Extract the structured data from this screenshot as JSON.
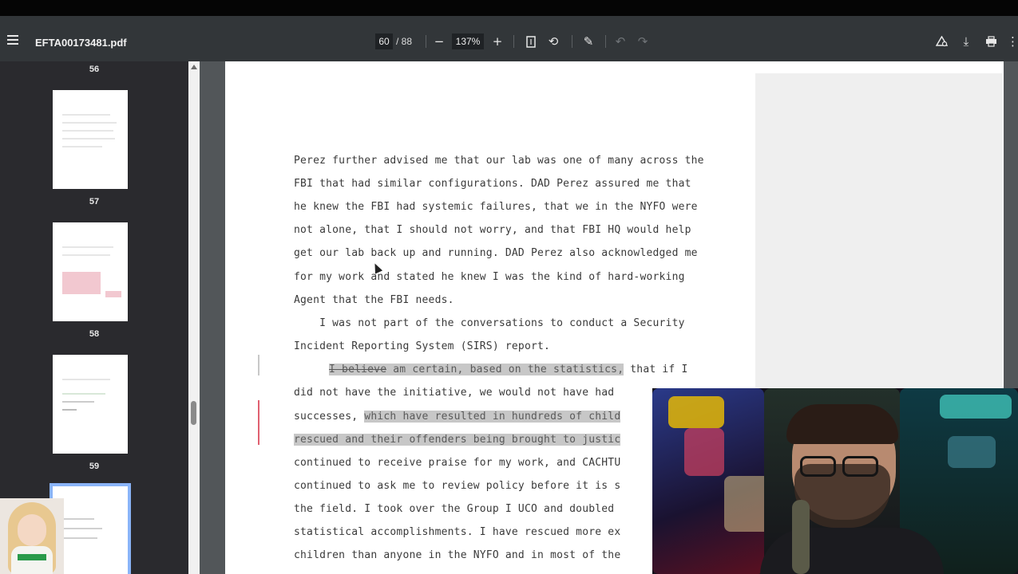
{
  "toolbar": {
    "file_name": "EFTA00173481.pdf",
    "current_page": "60",
    "total_pages": "/ 88",
    "zoom": "137%",
    "icons": [
      "menu-icon",
      "zoom-out-icon",
      "zoom-in-icon",
      "fit-page-icon",
      "rotate-icon",
      "annotate-icon",
      "undo-icon",
      "redo-icon",
      "drive-icon",
      "download-icon",
      "print-icon",
      "more-icon"
    ]
  },
  "sidebar": {
    "thumbnails": [
      {
        "label": "56"
      },
      {
        "label": "57"
      },
      {
        "label": "58"
      },
      {
        "label": "59"
      }
    ]
  },
  "document": {
    "lines": [
      "Perez further advised me that our lab was one of many across the",
      "FBI that had similar configurations. DAD Perez assured me that",
      "he knew the FBI had systemic failures, that we in the NYFO were",
      "not alone, that I should not worry, and that FBI HQ would help",
      "get our lab back up and running. DAD Perez also acknowledged me",
      "for my work and stated he knew I was the kind of hard-working",
      "Agent that the FBI needs.",
      "    I was not part of the conversations to conduct a Security",
      "Incident Reporting System (SIRS) report."
    ],
    "line_10_struck": "I believe",
    "line_10_highlight": " am certain, based on the statistics,",
    "line_10_rest": " that if I",
    "line_11": "did not have the initiative, we would not have had",
    "line_12_plain": "successes, ",
    "line_12_highlight": "which have resulted in hundreds of child",
    "line_13_highlight": "rescued and their offenders being brought to justic",
    "line_14": "continued to receive praise for my work, and CACHTU",
    "line_15": "continued to ask me to review policy before it is s",
    "line_16": "the field. I took over the Group I UCO and doubled",
    "line_17": "statistical accomplishments. I have rescued more ex",
    "line_18": "children than anyone in the NYFO and in most of the"
  },
  "colors": {
    "toolbar": "#323639",
    "sidebar": "#2a2a2e",
    "document_bg": "#525659",
    "highlight": "#c7c7c7",
    "selected_thumb": "#8ab4f8",
    "margin_mark": "#e06070"
  }
}
